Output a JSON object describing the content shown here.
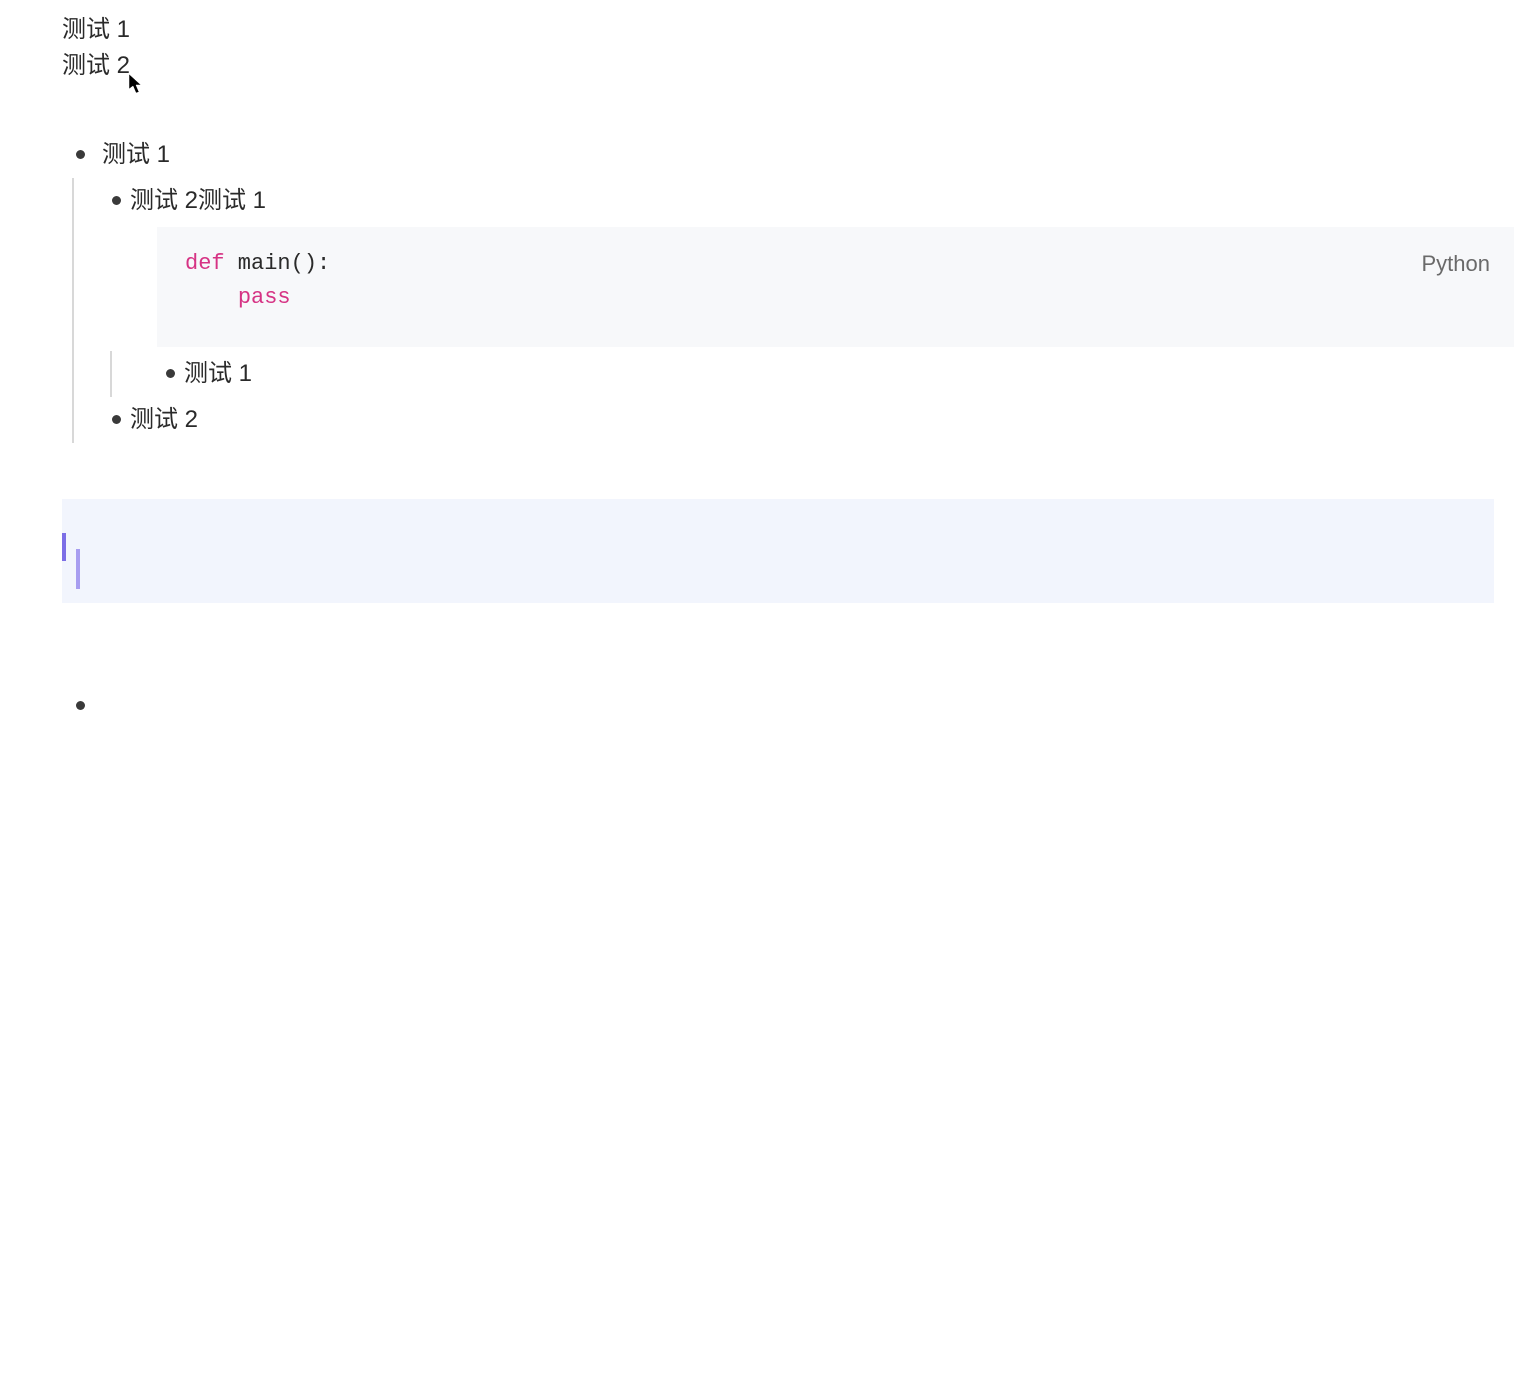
{
  "plain": {
    "line1": "测试 1",
    "line2": "测试 2"
  },
  "list": {
    "item1": "测试 1",
    "sub": {
      "item1": "测试 2测试 1",
      "code": {
        "language": "Python",
        "keyword_def": "def",
        "func_name": " main():",
        "keyword_pass": "pass"
      },
      "inner_item1": "测试 1"
    },
    "item2": "测试 2"
  },
  "empty_bullet": ""
}
